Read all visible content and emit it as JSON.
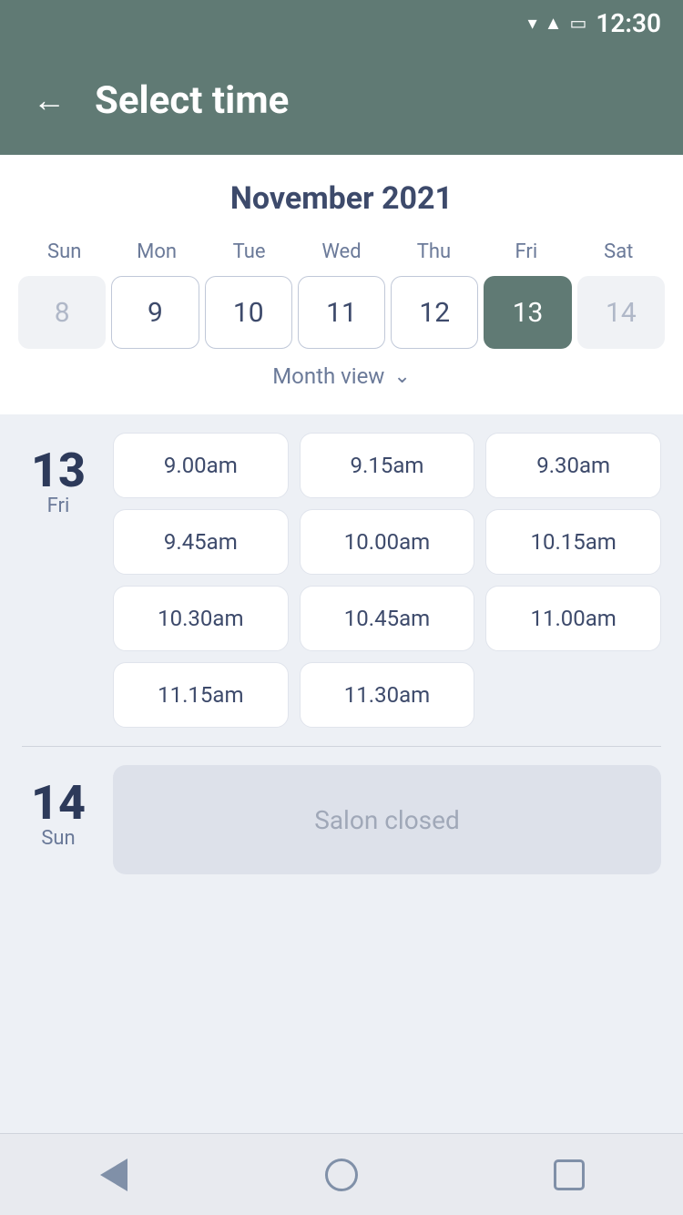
{
  "statusBar": {
    "time": "12:30"
  },
  "header": {
    "title": "Select time",
    "back_label": "←"
  },
  "calendar": {
    "month": "November 2021",
    "dayHeaders": [
      "Sun",
      "Mon",
      "Tue",
      "Wed",
      "Thu",
      "Fri",
      "Sat"
    ],
    "dates": [
      {
        "value": "8",
        "state": "disabled"
      },
      {
        "value": "9",
        "state": "bordered"
      },
      {
        "value": "10",
        "state": "bordered"
      },
      {
        "value": "11",
        "state": "bordered"
      },
      {
        "value": "12",
        "state": "bordered"
      },
      {
        "value": "13",
        "state": "selected"
      },
      {
        "value": "14",
        "state": "disabled"
      }
    ],
    "monthViewLabel": "Month view"
  },
  "timeSlotsDay13": {
    "dayNumber": "13",
    "dayName": "Fri",
    "slots": [
      "9.00am",
      "9.15am",
      "9.30am",
      "9.45am",
      "10.00am",
      "10.15am",
      "10.30am",
      "10.45am",
      "11.00am",
      "11.15am",
      "11.30am"
    ]
  },
  "timeSlotsDay14": {
    "dayNumber": "14",
    "dayName": "Sun",
    "closedLabel": "Salon closed"
  }
}
